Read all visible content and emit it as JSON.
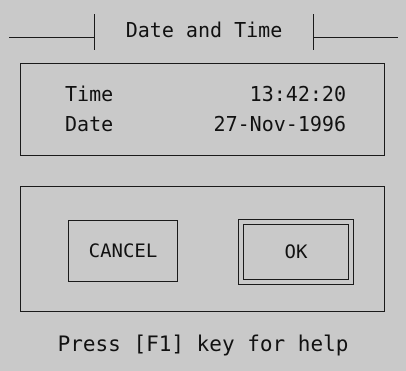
{
  "dialog": {
    "title": "Date and Time"
  },
  "info": {
    "time_label": "Time",
    "time_value": "13:42:20",
    "date_label": "Date",
    "date_value": "27-Nov-1996"
  },
  "buttons": {
    "cancel_label": "CANCEL",
    "ok_label": "OK",
    "default_button": "OK"
  },
  "footer": {
    "help_text": "Press [F1] key for help"
  }
}
